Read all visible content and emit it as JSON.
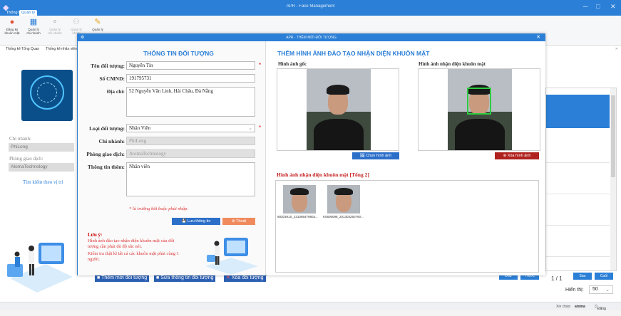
{
  "app": {
    "title": "APR - Face Management",
    "ribbon_tabs": [
      "Thống kê",
      "Quản lý"
    ],
    "ribbon_buttons": [
      "Đăng ký khuôn mặt",
      "Quản lý chi nhánh",
      "Quản lý chi nhánh",
      "Quản lý nhóm",
      "Quản lý"
    ],
    "sub_tabs": [
      "Thống kê Tổng Quan",
      "Thống kê nhân viên"
    ]
  },
  "left_panel": {
    "search_label": "Tìm kiếm theo vị trí",
    "branch_label": "Chi nhánh:",
    "branch_value": "PhiLong",
    "office_label": "Phòng giao dịch:",
    "office_value": "AtomaTechnology"
  },
  "dialog": {
    "title": "APR - THÊM MỚI ĐỐI TƯỢNG",
    "close": "✕",
    "info_title": "THÔNG TIN ĐỐI TƯỢNG",
    "fields": {
      "name_label": "Tên đối tượng:",
      "name_value": "Nguyễn Tín",
      "cmnd_label": "Số CMND:",
      "cmnd_value": "191795731",
      "address_label": "Địa chỉ:",
      "address_value": "52 Nguyễn Văn Linh, Hải Châu, Đà Nẵng",
      "type_label": "Loại đối tượng:",
      "type_value": "Nhân Viên",
      "branch_label": "Chi nhánh:",
      "branch_value": "PhiLong",
      "office_label": "Phòng giao dịch:",
      "office_value": "AtomaTechnology",
      "extra_label": "Thông tin thêm:",
      "extra_value": "Nhân viên"
    },
    "required_mark": "*",
    "required_note": "* là trường bắt buộc phải nhập.",
    "save_button": "Lưu thông tin",
    "exit_button": "Thoát",
    "note_title": "Lưu ý:",
    "note_1": "Hình ảnh đào tạo nhận diện khuôn mặt của đối tượng cần phải đủ độ sắc nét.",
    "note_2": "Kiểm tra thật kĩ tất cả các khuôn mặt phải cùng 1 người.",
    "images_title": "THÊM HÌNH ẢNH ĐÀO TẠO NHẬN DIỆN KHUÔN MẶT",
    "original_label": "Hình ảnh gốc",
    "recognized_label": "Hình ảnh nhận diện khuôn mặt",
    "choose_button": "Chọn hình ảnh",
    "delete_button": "Xóa hình ảnh",
    "recognized_list_title": "Hình ảnh nhận diện khuôn mặt [Tổng 2]",
    "thumbnails": [
      "6830391S_231086479803...",
      "K0606098_201303250790..."
    ]
  },
  "bottom": {
    "add_button": "Thêm mới đối tượng",
    "edit_button": "Sửa thông tin đối tượng",
    "delete_button": "Xóa đối tượng",
    "pager": "1 / 1",
    "nav_labels": [
      "Đầu",
      "Trước",
      "Sau",
      "Cuối"
    ],
    "page_size_label": "Hiển thị:",
    "page_size_value": "50"
  },
  "status": {
    "greeting": "Xin chào:",
    "user": "atoma",
    "logout": "Đăng xuất"
  }
}
